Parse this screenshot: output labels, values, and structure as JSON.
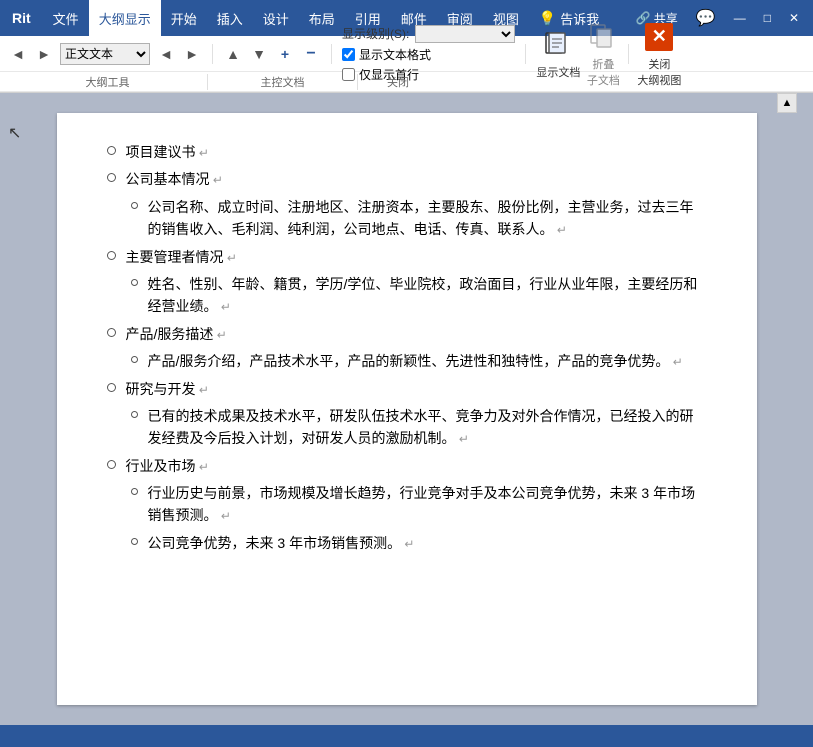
{
  "titlebar": {
    "app_name": "Rit",
    "menus": [
      "文件",
      "大纲显示",
      "开始",
      "插入",
      "设计",
      "布局",
      "引用",
      "邮件",
      "审阅",
      "视图"
    ],
    "active_tab": "大纲显示",
    "tell_me": "告诉我",
    "share": "共享"
  },
  "ribbon": {
    "nav_buttons": [
      "◄",
      "►",
      "◄",
      "►"
    ],
    "style_select": "正文文本",
    "promote_demote": [
      "▲",
      "▼",
      "+",
      "−"
    ],
    "show_level_label": "显示级别(S):",
    "show_text_formatting": "显示文本格式",
    "show_first_line_only": "仅显示首行",
    "outline_tools_label": "大纲工具",
    "show_document_label": "显示文档",
    "collapse_btn": "折叠\n子文档",
    "close_outline_label": "关闭\n大纲视图",
    "master_doc_label": "主控文档",
    "close_label": "关闭"
  },
  "document": {
    "items": [
      {
        "level": 1,
        "text": "项目建议书",
        "has_return": true
      },
      {
        "level": 1,
        "text": "公司基本情况",
        "has_return": true
      },
      {
        "level": 2,
        "text": "公司名称、成立时间、注册地区、注册资本，主要股东、股份比例，主营业务，过去三年的销售收入、毛利润、纯利润，公司地点、电话、传真、联系人。",
        "has_return": true
      },
      {
        "level": 1,
        "text": "主要管理者情况",
        "has_return": true
      },
      {
        "level": 2,
        "text": "姓名、性别、年龄、籍贯，学历/学位、毕业院校，政治面目，行业从业年限，主要经历和经营业绩。",
        "has_return": true
      },
      {
        "level": 1,
        "text": "产品/服务描述",
        "has_return": true
      },
      {
        "level": 2,
        "text": "产品/服务介绍，产品技术水平，产品的新颖性、先进性和独特性，产品的竞争优势。",
        "has_return": true
      },
      {
        "level": 1,
        "text": "研究与开发",
        "has_return": true
      },
      {
        "level": 2,
        "text": "已有的技术成果及技术水平，研发队伍技术水平、竞争力及对外合作情况，已经投入的研发经费及今后投入计划，对研发人员的激励机制。",
        "has_return": true
      },
      {
        "level": 1,
        "text": "行业及市场",
        "has_return": true
      },
      {
        "level": 2,
        "text": "行业历史与前景，市场规模及增长趋势，行业竞争对手及本公司竞争优势，未来 3 年市场销售预测。",
        "has_return": true
      },
      {
        "level": 2,
        "text": "公司竞争优势，未来 3 年市场销售预测。",
        "has_return": true,
        "partial": true
      }
    ]
  }
}
